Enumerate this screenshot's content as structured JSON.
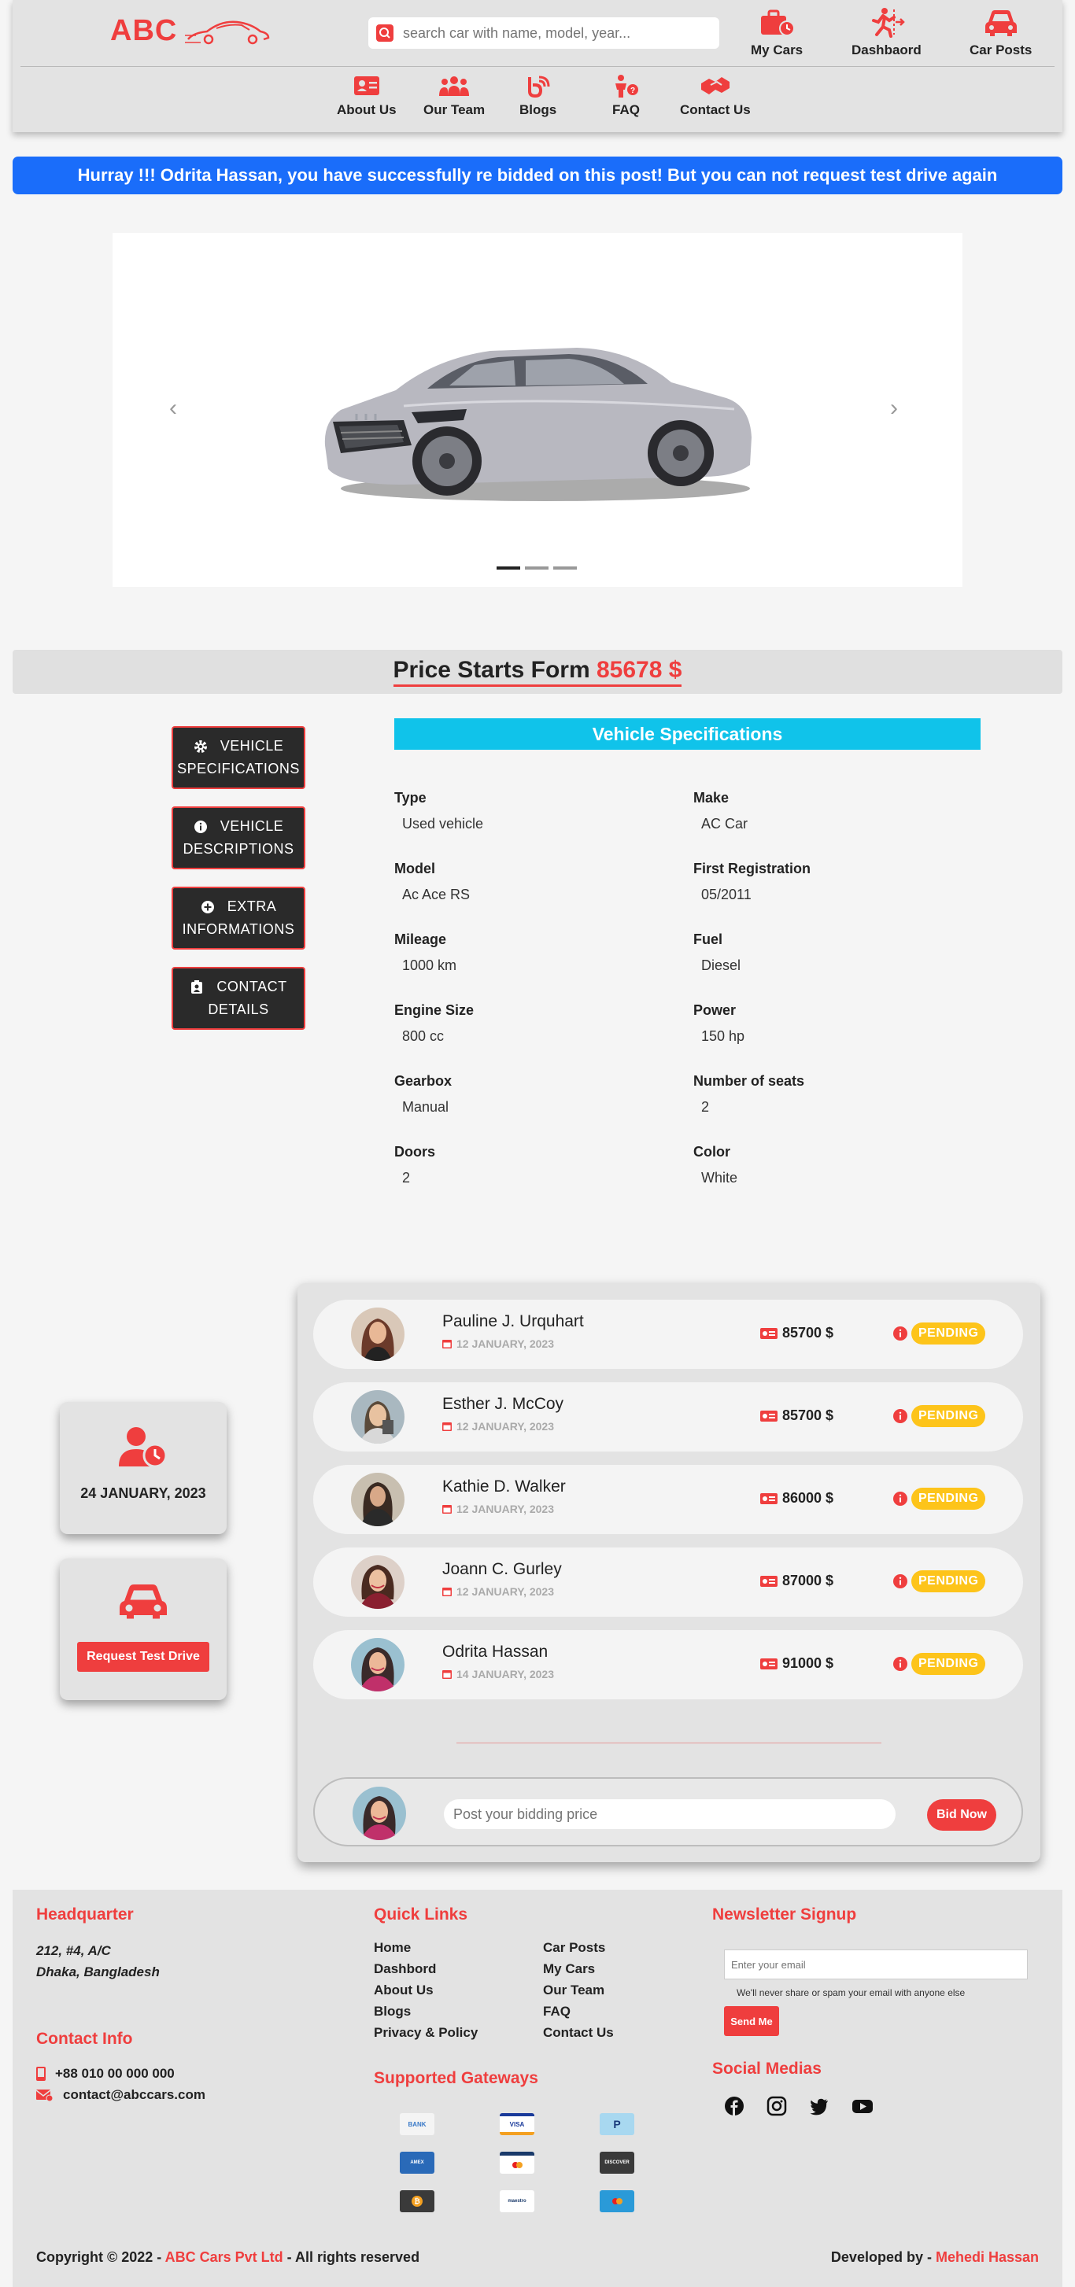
{
  "header": {
    "logo_text": "ABC",
    "search_placeholder": "search car with name, model, year...",
    "top_nav": [
      {
        "label": "My Cars",
        "icon": "briefcase-clock-icon"
      },
      {
        "label": "Dashbaord",
        "icon": "person-running-icon"
      },
      {
        "label": "Car Posts",
        "icon": "car-icon"
      }
    ],
    "sub_nav": [
      {
        "label": "About Us",
        "icon": "id-card-icon"
      },
      {
        "label": "Our Team",
        "icon": "team-icon"
      },
      {
        "label": "Blogs",
        "icon": "blog-icon"
      },
      {
        "label": "FAQ",
        "icon": "person-question-icon"
      },
      {
        "label": "Contact Us",
        "icon": "handshake-icon"
      }
    ]
  },
  "alert": {
    "message": "Hurray !!! Odrita Hassan, you have successfully re bidded on this post! But you can not request test drive again"
  },
  "carousel": {
    "prev_glyph": "‹",
    "next_glyph": "›",
    "slide_count": 3,
    "active_index": 0,
    "car_color": "#b8b8c0"
  },
  "price": {
    "label": "Price Starts Form",
    "value": "85678 $"
  },
  "spec_buttons": [
    {
      "line1": "VEHICLE",
      "line2": "SPECIFICATIONS",
      "icon": "gear-icon"
    },
    {
      "line1": "VEHICLE",
      "line2": "DESCRIPTIONS",
      "icon": "info-icon"
    },
    {
      "line1": "EXTRA",
      "line2": "INFORMATIONS",
      "icon": "plus-circle-icon"
    },
    {
      "line1": "CONTACT",
      "line2": "DETAILS",
      "icon": "contact-card-icon"
    }
  ],
  "specifications": {
    "title": "Vehicle Specifications",
    "items": [
      {
        "key": "Type",
        "value": "Used vehicle"
      },
      {
        "key": "Make",
        "value": "AC Car"
      },
      {
        "key": "Model",
        "value": "Ac Ace RS"
      },
      {
        "key": "First Registration",
        "value": "05/2011"
      },
      {
        "key": "Mileage",
        "value": "1000 km"
      },
      {
        "key": "Fuel",
        "value": "Diesel"
      },
      {
        "key": "Engine Size",
        "value": "800 cc"
      },
      {
        "key": "Power",
        "value": "150 hp"
      },
      {
        "key": "Gearbox",
        "value": "Manual"
      },
      {
        "key": "Number of seats",
        "value": "2"
      },
      {
        "key": "Doors",
        "value": "2"
      },
      {
        "key": "Color",
        "value": "White"
      }
    ]
  },
  "side_cards": {
    "date": "24 JANUARY, 2023",
    "request_button": "Request Test Drive"
  },
  "bids": {
    "rows": [
      {
        "name": "Pauline J. Urquhart",
        "date": "12 JANUARY, 2023",
        "amount": "85700 $",
        "status": "PENDING",
        "avatar_color": "#6b3a2a"
      },
      {
        "name": "Esther J. McCoy",
        "date": "12 JANUARY, 2023",
        "amount": "85700 $",
        "status": "PENDING",
        "avatar_color": "#7b8a94"
      },
      {
        "name": "Kathie D. Walker",
        "date": "12 JANUARY, 2023",
        "amount": "86000 $",
        "status": "PENDING",
        "avatar_color": "#4a3a30"
      },
      {
        "name": "Joann C. Gurley",
        "date": "12 JANUARY, 2023",
        "amount": "87000 $",
        "status": "PENDING",
        "avatar_color": "#8a2030"
      },
      {
        "name": "Odrita Hassan",
        "date": "14 JANUARY, 2023",
        "amount": "91000 $",
        "status": "PENDING",
        "avatar_color": "#3a6a8a"
      }
    ],
    "input_placeholder": "Post your bidding price",
    "submit_label": "Bid Now"
  },
  "footer": {
    "hq_title": "Headquarter",
    "hq_line1": "212, #4, A/C",
    "hq_line2": "Dhaka, Bangladesh",
    "contact_title": "Contact Info",
    "phone": "+88 010 00 000 000",
    "email": "contact@abccars.com",
    "quick_links_title": "Quick Links",
    "quick_links": [
      "Home",
      "Car Posts",
      "Dashbord",
      "My Cars",
      "About Us",
      "Our Team",
      "Blogs",
      "FAQ",
      "Privacy & Policy",
      "Contact Us"
    ],
    "gateways_title": "Supported Gateways",
    "gateways": [
      "BANK",
      "VISA",
      "P",
      "AMEX",
      "",
      "DISCOVER",
      "",
      "maestro",
      ""
    ],
    "newsletter_title": "Newsletter Signup",
    "newsletter_placeholder": "Enter your email",
    "newsletter_note": "We'll never share or spam your email with anyone else",
    "newsletter_button": "Send Me",
    "social_title": "Social Medias",
    "copyright_prefix": "Copyright © 2022 - ",
    "copyright_company": "ABC Cars Pvt Ltd",
    "copyright_suffix": " - All rights reserved",
    "developed_prefix": "Developed by - ",
    "developer": "Mehedi Hassan"
  },
  "colors": {
    "brand_red": "#ef3e3e",
    "alert_blue": "#1a6dfa",
    "spec_cyan": "#10c3ea",
    "pending_yellow": "#fdc41a"
  }
}
